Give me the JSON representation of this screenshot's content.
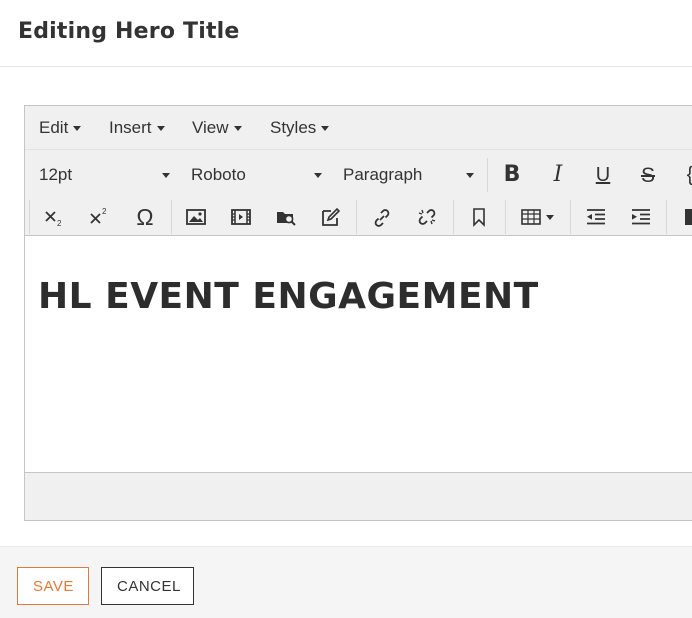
{
  "header": {
    "title": "Editing Hero Title"
  },
  "menubar": {
    "items": [
      {
        "label": "Edit"
      },
      {
        "label": "Insert"
      },
      {
        "label": "View"
      },
      {
        "label": "Styles"
      }
    ]
  },
  "toolbar": {
    "font_size": "12pt",
    "font_family": "Roboto",
    "block_format": "Paragraph",
    "bold_glyph": "B",
    "italic_glyph": "I",
    "underline_glyph": "U",
    "strike_glyph": "S",
    "source_glyph": "{",
    "omega_glyph": "Ω"
  },
  "content": {
    "text": "HL EVENT ENGAGEMENT"
  },
  "footer": {
    "save_label": "SAVE",
    "cancel_label": "CANCEL"
  },
  "colors": {
    "accent": "#e07b39",
    "toolbar_bg": "#f0f0f0",
    "text": "#333333"
  }
}
